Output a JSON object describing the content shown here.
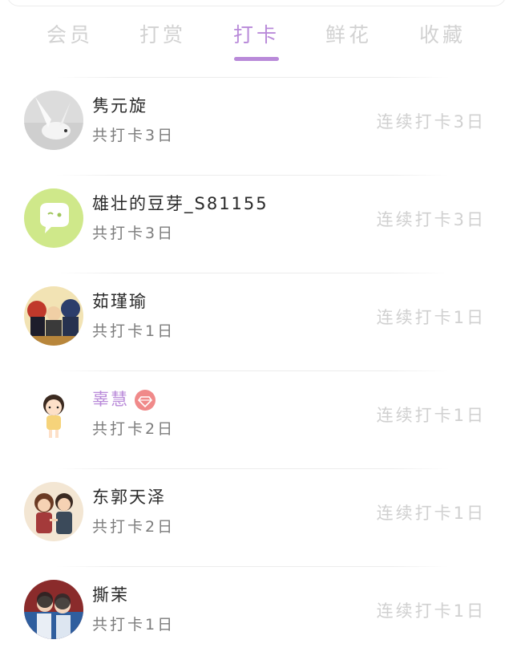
{
  "tabs": [
    {
      "label": "会员",
      "active": false
    },
    {
      "label": "打赏",
      "active": false
    },
    {
      "label": "打卡",
      "active": true
    },
    {
      "label": "鲜花",
      "active": false
    },
    {
      "label": "收藏",
      "active": false
    }
  ],
  "colors": {
    "accent": "#b98ad9",
    "muted": "#d0d0d0",
    "badge": "#f08a8a"
  },
  "checkins": [
    {
      "name": "隽元旋",
      "total": "共打卡3日",
      "streak": "连续打卡3日",
      "avatar": "white-bird-avatar",
      "vip": false
    },
    {
      "name": "雄壮的豆芽_S81155",
      "total": "共打卡3日",
      "streak": "连续打卡3日",
      "avatar": "green-chat-bubble-avatar",
      "vip": false
    },
    {
      "name": "茹瑾瑜",
      "total": "共打卡1日",
      "streak": "连续打卡1日",
      "avatar": "opera-figures-avatar",
      "vip": false
    },
    {
      "name": "辜慧",
      "total": "共打卡2日",
      "streak": "连续打卡1日",
      "avatar": "cartoon-girl-avatar",
      "vip": true,
      "badge_icon": "diamond-icon"
    },
    {
      "name": "东郭天泽",
      "total": "共打卡2日",
      "streak": "连续打卡1日",
      "avatar": "cartoon-couple-avatar",
      "vip": false
    },
    {
      "name": "撕茉",
      "total": "共打卡1日",
      "streak": "连续打卡1日",
      "avatar": "photo-people-avatar",
      "vip": false
    }
  ]
}
